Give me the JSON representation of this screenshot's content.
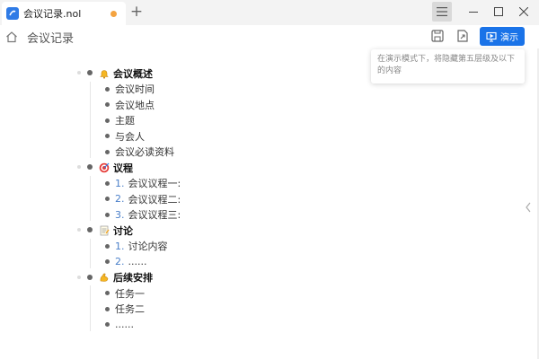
{
  "tab": {
    "title": "会议记录.nol",
    "new_tab": "+"
  },
  "toolbar": {
    "doc_title": "会议记录",
    "present_label": "演示"
  },
  "tooltip": {
    "text": "在演示模式下，将隐藏第五层级及以下的内容"
  },
  "icons": {
    "accent": "#1a73e8",
    "unsaved_dot": "#f4a340",
    "number_color": "#4a7fc9"
  },
  "outline": {
    "sections": [
      {
        "title": "会议概述",
        "icon": "bell-icon",
        "items": [
          "会议时间",
          "会议地点",
          "主题",
          "与会人",
          "会议必读资料"
        ]
      },
      {
        "title": "议程",
        "icon": "target-icon",
        "numbers": [
          "1.",
          "2.",
          "3."
        ],
        "items": [
          "会议议程一:",
          "会议议程二:",
          "会议议程三:"
        ]
      },
      {
        "title": "讨论",
        "icon": "memo-icon",
        "numbers": [
          "1.",
          "2."
        ],
        "items": [
          "讨论内容",
          "......"
        ]
      },
      {
        "title": "后续安排",
        "icon": "flexed-arm-icon",
        "items": [
          "任务一",
          "任务二",
          "......"
        ]
      }
    ]
  }
}
